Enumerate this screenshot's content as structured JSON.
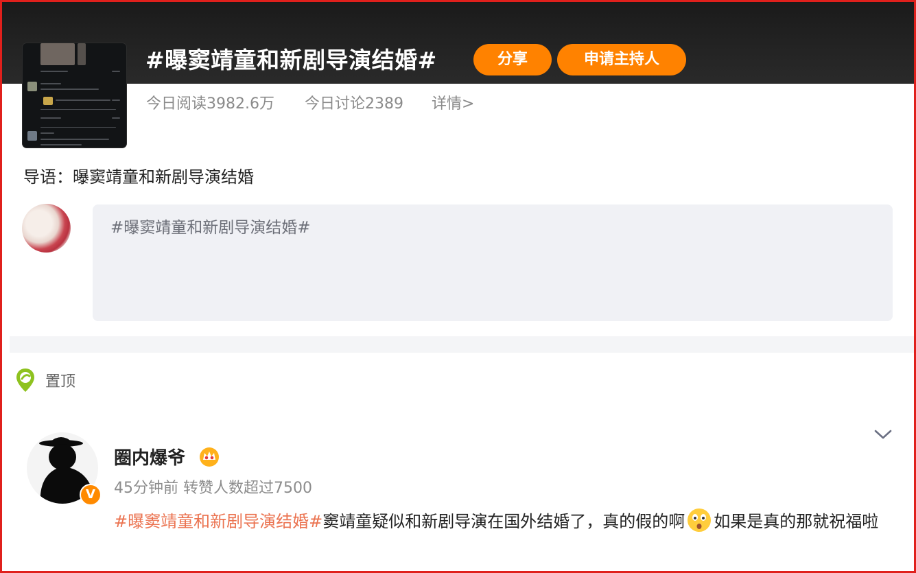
{
  "topic": {
    "title": "#曝窦靖童和新剧导演结婚#",
    "share_label": "分享",
    "host_label": "申请主持人",
    "reads": "今日阅读3982.6万",
    "discussions": "今日讨论2389",
    "details_link": "详情>",
    "intro": "导语：曝窦靖童和新剧导演结婚"
  },
  "composer": {
    "prefill": "#曝窦靖童和新剧导演结婚#"
  },
  "pinned": {
    "label": "置顶"
  },
  "post": {
    "author": "圈内爆爷",
    "meta": "45分钟前 转赞人数超过7500",
    "hashtag": "#曝窦靖童和新剧导演结婚#",
    "text_before_emoji": "窦靖童疑似和新剧导演在国外结婚了，真的假的啊",
    "text_after_emoji": "如果是真的那就祝福啦",
    "emoji_icon": "shocked-face",
    "badge_text": "V"
  },
  "colors": {
    "accent_orange": "#ff8200",
    "hashtag_color": "#eb7350",
    "frame_red": "#e0201c"
  }
}
